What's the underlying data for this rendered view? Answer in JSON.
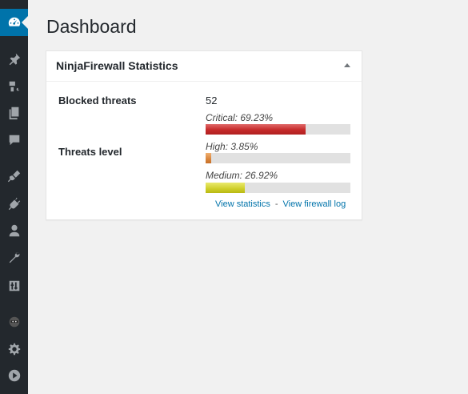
{
  "sidebar": {
    "items": [
      {
        "icon": "dashboard-icon",
        "active": true
      },
      {
        "icon": "pin-icon"
      },
      {
        "icon": "media-icon"
      },
      {
        "icon": "pages-icon"
      },
      {
        "icon": "comments-icon"
      },
      {
        "icon": "appearance-icon"
      },
      {
        "icon": "plugins-icon"
      },
      {
        "icon": "users-icon"
      },
      {
        "icon": "tools-icon"
      },
      {
        "icon": "settings-sliders-icon"
      },
      {
        "icon": "ninjafirewall-icon"
      },
      {
        "icon": "gear-icon"
      },
      {
        "icon": "play-icon"
      }
    ],
    "accent": "#0073aa"
  },
  "page": {
    "title": "Dashboard"
  },
  "widget": {
    "title": "NinjaFirewall Statistics",
    "blocked_label": "Blocked threats",
    "blocked_value": "52",
    "level_label": "Threats level",
    "levels": [
      {
        "caption": "Critical: 69.23%",
        "percent": 69.23,
        "color": "#c62a2a"
      },
      {
        "caption": "High: 3.85%",
        "percent": 3.85,
        "color": "#d8843c"
      },
      {
        "caption": "Medium: 26.92%",
        "percent": 26.92,
        "color": "#cfcf2a"
      }
    ],
    "link_statistics": "View statistics",
    "link_separator": "-",
    "link_log": "View firewall log"
  }
}
